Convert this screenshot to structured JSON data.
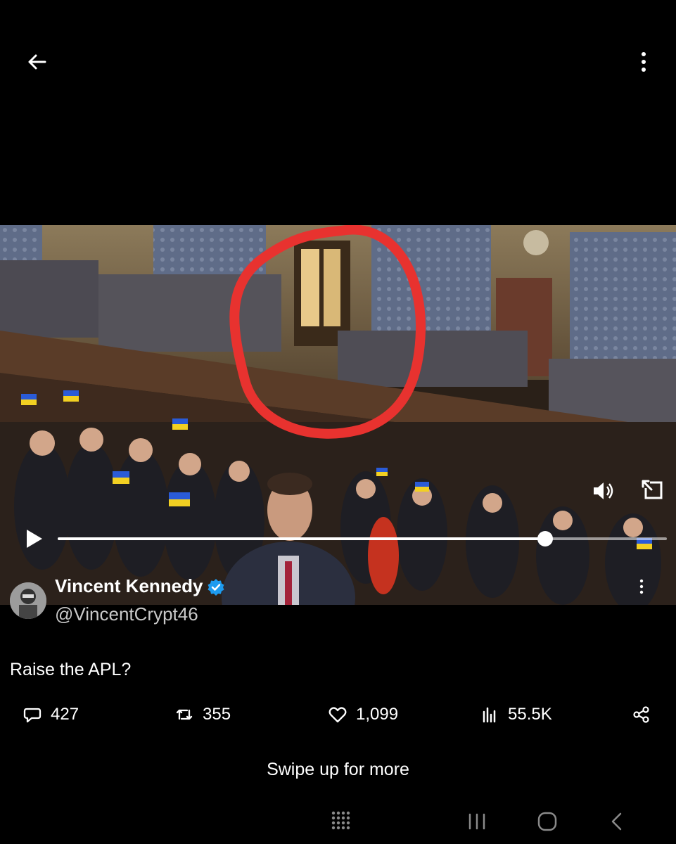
{
  "topbar": {
    "back_icon": "arrow-left-icon",
    "more_icon": "more-vertical-icon"
  },
  "video": {
    "controls": {
      "volume_icon": "volume-icon",
      "pip_icon": "pip-icon",
      "play_icon": "play-icon"
    },
    "progress": 0.8
  },
  "author": {
    "name": "Vincent Kennedy",
    "handle": "@VincentCrypt46",
    "verified": true
  },
  "tweet": {
    "text": "Raise the APL?"
  },
  "actions": {
    "replies": "427",
    "retweets": "355",
    "likes": "1,099",
    "views": "55.5K"
  },
  "swipe_hint": "Swipe up for more",
  "colors": {
    "annotation": "#e8322f",
    "verified": "#1d9bf0"
  }
}
